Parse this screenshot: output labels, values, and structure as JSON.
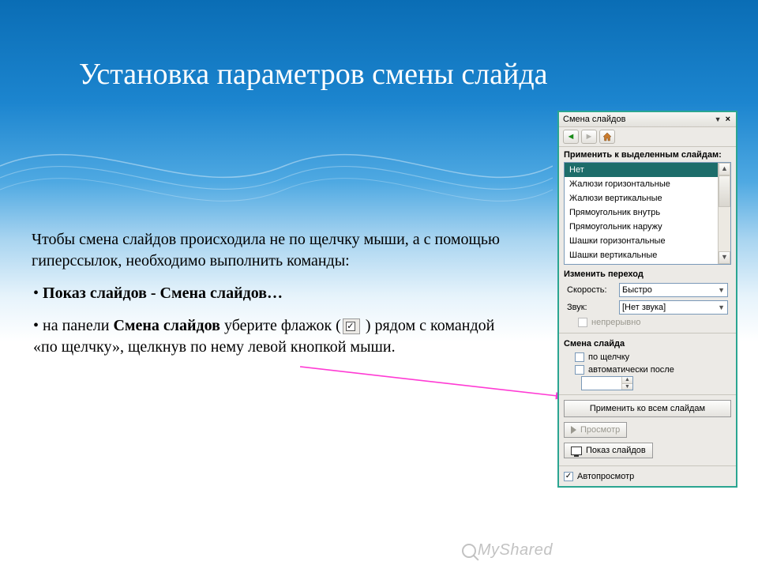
{
  "title": "Установка параметров смены слайда",
  "body": {
    "intro": "Чтобы смена слайдов происходила не по щелчку мыши, а с помощью гиперссылок, необходимо выполнить команды:",
    "bullet1": "Показ слайдов - Смена слайдов…",
    "bullet2_before": "на панели ",
    "bullet2_bold": "Смена слайдов",
    "bullet2_mid": " уберите флажок (",
    "bullet2_after": " ) рядом с командой «по щелчку», щелкнув по нему левой кнопкой мыши."
  },
  "panel": {
    "title": "Смена слайдов",
    "apply_label": "Применить к выделенным слайдам:",
    "transitions": [
      "Нет",
      "Жалюзи горизонтальные",
      "Жалюзи вертикальные",
      "Прямоугольник внутрь",
      "Прямоугольник наружу",
      "Шашки горизонтальные",
      "Шашки вертикальные"
    ],
    "selected_transition_index": 0,
    "modify_label": "Изменить переход",
    "speed_label": "Скорость:",
    "speed_value": "Быстро",
    "sound_label": "Звук:",
    "sound_value": "[Нет звука]",
    "loop_label": "непрерывно",
    "advance_label": "Смена слайда",
    "on_click_label": "по щелчку",
    "auto_after_label": "автоматически после",
    "time_value": "",
    "apply_all_btn": "Применить ко всем слайдам",
    "preview_btn": "Просмотр",
    "slideshow_btn": "Показ слайдов",
    "autopreview_label": "Автопросмотр"
  },
  "watermark": "MyShared"
}
